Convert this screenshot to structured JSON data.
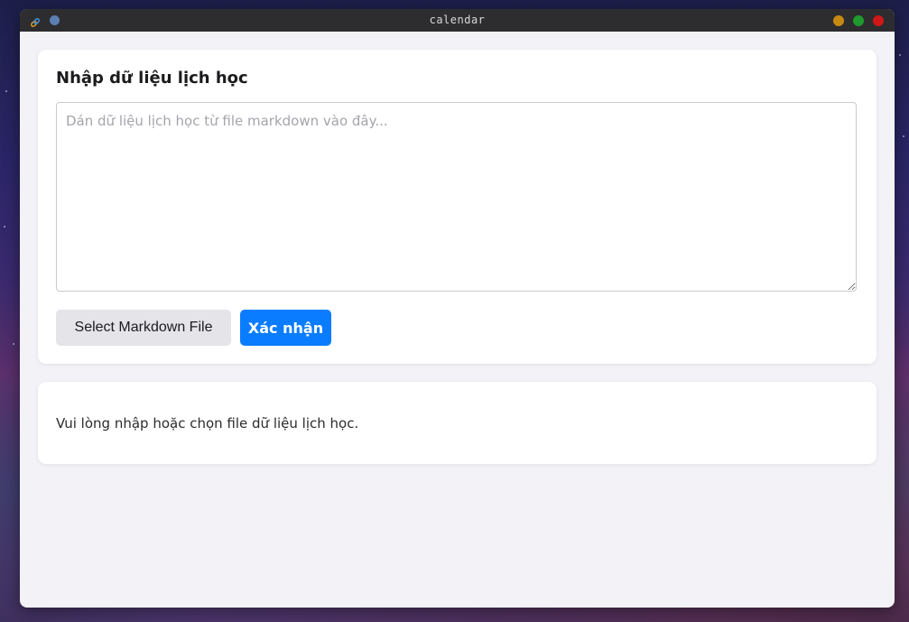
{
  "window": {
    "title": "calendar",
    "controls": {
      "minimize_color": "#c78a10",
      "maximize_color": "#1f9a2c",
      "close_color": "#d01717"
    },
    "app_icon": "link-icon"
  },
  "input_card": {
    "title": "Nhập dữ liệu lịch học",
    "textarea": {
      "value": "",
      "placeholder": "Dán dữ liệu lịch học từ file markdown vào đây..."
    },
    "select_file_label": "Select Markdown File",
    "confirm_label": "Xác nhận"
  },
  "result_card": {
    "message": "Vui lòng nhập hoặc chọn file dữ liệu lịch học."
  },
  "colors": {
    "accent": "#0a7cff",
    "secondary_button": "#e4e4e9",
    "window_background": "#f2f2f7",
    "titlebar": "#2d2d30"
  }
}
